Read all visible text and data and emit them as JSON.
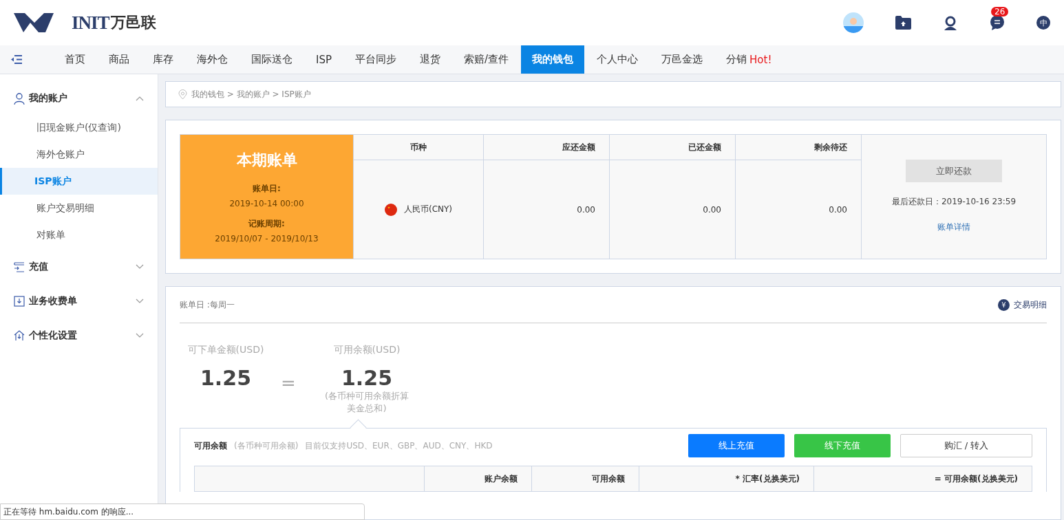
{
  "header": {
    "logo_mark": "INIT",
    "logo_name": "万邑联",
    "notification_count": "26",
    "language": "中"
  },
  "nav": {
    "items": [
      {
        "label": "首页",
        "selected": false
      },
      {
        "label": "商品",
        "selected": false
      },
      {
        "label": "库存",
        "selected": false
      },
      {
        "label": "海外仓",
        "selected": false
      },
      {
        "label": "国际送仓",
        "selected": false
      },
      {
        "label": "ISP",
        "selected": false
      },
      {
        "label": "平台同步",
        "selected": false
      },
      {
        "label": "退货",
        "selected": false
      },
      {
        "label": "索赔/查件",
        "selected": false
      },
      {
        "label": "我的钱包",
        "selected": true
      },
      {
        "label": "个人中心",
        "selected": false
      },
      {
        "label": "万邑金选",
        "selected": false
      },
      {
        "label": "分销",
        "badge": "Hot!",
        "selected": false
      }
    ]
  },
  "sidebar": {
    "groups": [
      {
        "kind": "user",
        "label": "我的账户",
        "expanded": true,
        "children": [
          {
            "label": "旧现金账户(仅查询)",
            "selected": false
          },
          {
            "label": "海外仓账户",
            "selected": false
          },
          {
            "label": "ISP账户",
            "selected": true
          },
          {
            "label": "账户交易明细",
            "selected": false
          },
          {
            "label": "对账单",
            "selected": false
          }
        ]
      },
      {
        "kind": "recharge",
        "label": "充值",
        "expanded": false
      },
      {
        "kind": "bill",
        "label": "业务收费单",
        "expanded": false
      },
      {
        "kind": "settings",
        "label": "个性化设置",
        "expanded": false
      }
    ]
  },
  "breadcrumb": "我的钱包 > 我的账户 > ISP账户",
  "bill": {
    "title": "本期账单",
    "date_label": "账单日:",
    "date": "2019-10-14 00:00",
    "period_label": "记账周期:",
    "period": "2019/10/07 - 2019/10/13",
    "columns": [
      "币种",
      "应还金额",
      "已还金额",
      "剩余待还"
    ],
    "rows": [
      {
        "currency": "人民币(CNY)",
        "due": "0.00",
        "paid": "0.00",
        "remaining": "0.00"
      }
    ],
    "pay_button": "立即还款",
    "last_date": "最后还款日：2019-10-16 23:59",
    "details_link": "账单详情"
  },
  "balance": {
    "bill_day": "账单日 :每周一",
    "transactions_link": "交易明细",
    "transactions_icon": "¥",
    "orderable_label": "可下单金额(USD)",
    "orderable": "1.25",
    "equals": "=",
    "available_label": "可用余额(USD)",
    "available": "1.25",
    "available_note": "(各币种可用余额折算美金总和)",
    "panel": {
      "title": "可用余额",
      "subtitle": "(各币种可用余额)",
      "note": "目前仅支持USD、EUR、GBP、AUD、CNY、HKD",
      "buttons": [
        {
          "kind": "primary",
          "label": "线上充值"
        },
        {
          "kind": "success",
          "label": "线下充值"
        },
        {
          "kind": "plain",
          "label": "购汇 / 转入"
        }
      ],
      "columns": [
        "账户余额",
        "可用余额",
        "* 汇率(兑换美元)",
        "= 可用余额(兑换美元)"
      ]
    }
  },
  "status_bar": "正在等待 hm.baidu.com 的响应..."
}
